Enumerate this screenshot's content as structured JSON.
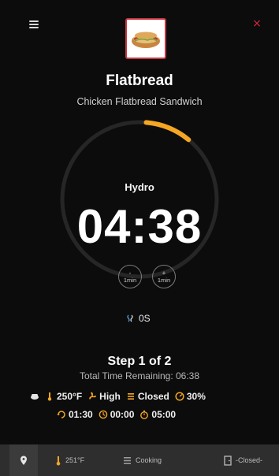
{
  "header": {
    "menu_icon": "hamburger-menu-icon",
    "close_icon": "close-icon",
    "close_glyph": "×",
    "accent_color": "#d62b3a"
  },
  "product": {
    "thumbnail": "flatbread-sandwich-image",
    "name": "Flatbread",
    "description": "Chicken Flatbread Sandwich"
  },
  "timer": {
    "mode": "Hydro",
    "time": "04:38",
    "progress_color": "#f5a623",
    "ring_color": "#262626"
  },
  "adjust": {
    "minus": {
      "sign": "-",
      "label": "1min"
    },
    "plus": {
      "sign": "+",
      "label": "1min"
    }
  },
  "steam": {
    "icon": "steam-icon",
    "value": "0S"
  },
  "step": {
    "label": "Step 1 of 2",
    "total_remaining": "Total Time Remaining: 06:38"
  },
  "settings": {
    "icon_color": "#f5a623",
    "row1": [
      {
        "icon": "food-icon",
        "value": ""
      },
      {
        "icon": "thermometer-icon",
        "value": "250°F"
      },
      {
        "icon": "fan-icon",
        "value": "High"
      },
      {
        "icon": "damper-icon",
        "value": "Closed"
      },
      {
        "icon": "humidity-gauge-icon",
        "value": "30%"
      }
    ],
    "row2": [
      {
        "icon": "cycle-icon",
        "value": "01:30"
      },
      {
        "icon": "clock-icon",
        "value": "00:00"
      },
      {
        "icon": "timer-icon",
        "value": "05:00"
      }
    ]
  },
  "footer": {
    "pin_icon": "location-pin-icon",
    "temperature": "251°F",
    "temperature_icon": "thermometer-icon",
    "status": "Cooking",
    "status_icon": "heating-icon",
    "door": "-Closed-",
    "door_icon": "door-icon"
  }
}
